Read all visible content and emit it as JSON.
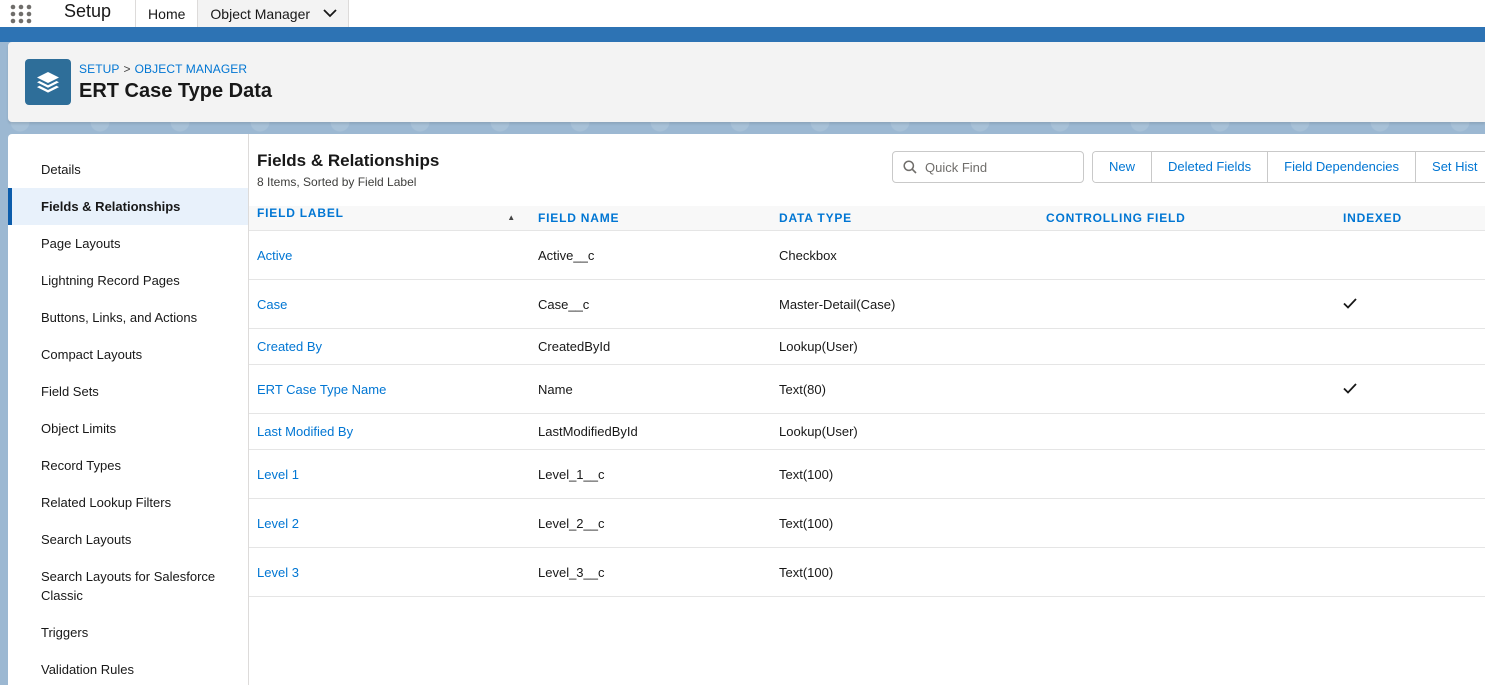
{
  "topbar": {
    "app_name": "Setup",
    "tabs": [
      {
        "label": "Home"
      },
      {
        "label": "Object Manager"
      }
    ]
  },
  "header": {
    "breadcrumb": [
      "SETUP",
      "OBJECT MANAGER"
    ],
    "breadcrumb_separator": ">",
    "title": "ERT Case Type Data"
  },
  "sidebar": {
    "items": [
      {
        "label": "Details"
      },
      {
        "label": "Fields & Relationships"
      },
      {
        "label": "Page Layouts"
      },
      {
        "label": "Lightning Record Pages"
      },
      {
        "label": "Buttons, Links, and Actions"
      },
      {
        "label": "Compact Layouts"
      },
      {
        "label": "Field Sets"
      },
      {
        "label": "Object Limits"
      },
      {
        "label": "Record Types"
      },
      {
        "label": "Related Lookup Filters"
      },
      {
        "label": "Search Layouts"
      },
      {
        "label": "Search Layouts for Salesforce Classic"
      },
      {
        "label": "Triggers"
      },
      {
        "label": "Validation Rules"
      }
    ],
    "active_index": 1
  },
  "main": {
    "title": "Fields & Relationships",
    "subtitle": "8 Items, Sorted by Field Label",
    "quick_find": {
      "placeholder": "Quick Find",
      "value": ""
    },
    "buttons": [
      "New",
      "Deleted Fields",
      "Field Dependencies",
      "Set Hist"
    ],
    "columns": [
      "FIELD LABEL",
      "FIELD NAME",
      "DATA TYPE",
      "CONTROLLING FIELD",
      "INDEXED"
    ],
    "rows": [
      {
        "label": "Active",
        "name": "Active__c",
        "type": "Checkbox",
        "controlling": "",
        "indexed": false
      },
      {
        "label": "Case",
        "name": "Case__c",
        "type": "Master-Detail(Case)",
        "controlling": "",
        "indexed": true
      },
      {
        "label": "Created By",
        "name": "CreatedById",
        "type": "Lookup(User)",
        "controlling": "",
        "indexed": false
      },
      {
        "label": "ERT Case Type Name",
        "name": "Name",
        "type": "Text(80)",
        "controlling": "",
        "indexed": true
      },
      {
        "label": "Last Modified By",
        "name": "LastModifiedById",
        "type": "Lookup(User)",
        "controlling": "",
        "indexed": false
      },
      {
        "label": "Level 1",
        "name": "Level_1__c",
        "type": "Text(100)",
        "controlling": "",
        "indexed": false
      },
      {
        "label": "Level 2",
        "name": "Level_2__c",
        "type": "Text(100)",
        "controlling": "",
        "indexed": false
      },
      {
        "label": "Level 3",
        "name": "Level_3__c",
        "type": "Text(100)",
        "controlling": "",
        "indexed": false
      }
    ]
  },
  "icons": {
    "app_launcher": "waffle-icon",
    "tab_menu": "chevron-down-icon",
    "object": "stack-layers-icon",
    "search": "search-icon",
    "sort": "sort-ascending-icon",
    "indexed": "checkmark-icon"
  },
  "colors": {
    "brand_blue": "#0176d3",
    "header_bar": "#2d73b4",
    "object_icon": "#2e6e99",
    "active_item": "#e8f1fb"
  }
}
